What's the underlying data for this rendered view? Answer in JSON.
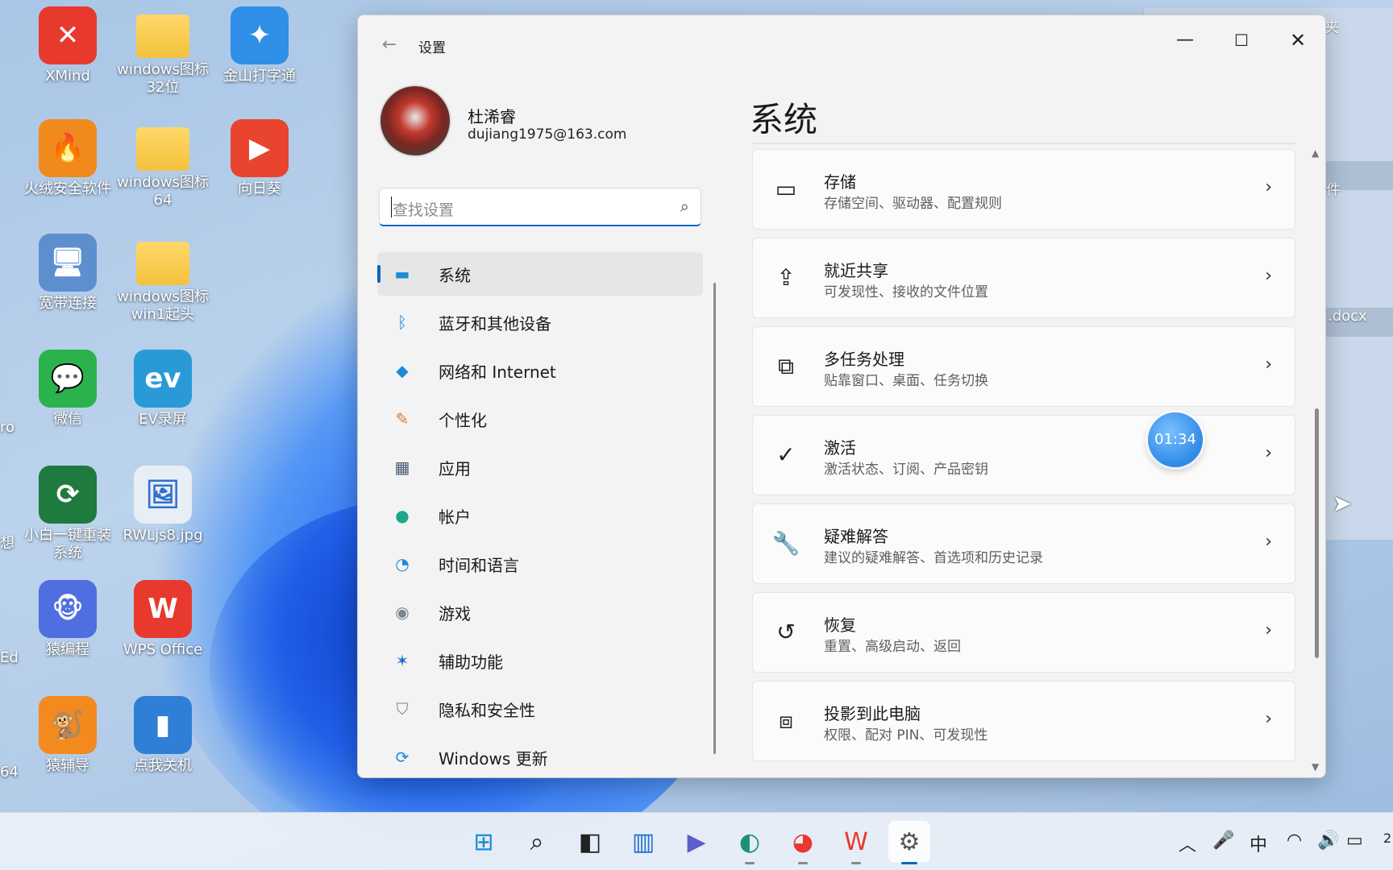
{
  "desktop": {
    "icons": [
      {
        "label": "XMind",
        "glyph": "✕",
        "color": "#e8392e",
        "icon": "xmind-icon"
      },
      {
        "label": "windows图标32位",
        "glyph": "",
        "color": "#f3c23c",
        "icon": "folder-icon"
      },
      {
        "label": "金山打字通",
        "glyph": "✦",
        "color": "#2f8ee6",
        "icon": "typing-app-icon"
      },
      {
        "label": "火绒安全软件",
        "glyph": "🔥",
        "color": "#f08a1c",
        "icon": "huorong-icon"
      },
      {
        "label": "windows图标64",
        "glyph": "",
        "color": "#f3c23c",
        "icon": "folder-icon"
      },
      {
        "label": "向日葵",
        "glyph": "▶",
        "color": "#e8442e",
        "icon": "sunflower-icon"
      },
      {
        "label": "宽带连接",
        "glyph": "🖥",
        "color": "#5d8fcf",
        "icon": "network-computer-icon"
      },
      {
        "label": "windows图标win1起头",
        "glyph": "",
        "color": "#f3c23c",
        "icon": "folder-icon"
      },
      {
        "label": "微信",
        "glyph": "💬",
        "color": "#2bb24c",
        "icon": "wechat-icon"
      },
      {
        "label": "EV录屏",
        "glyph": "ev",
        "color": "#2a9ad6",
        "icon": "ev-recorder-icon"
      },
      {
        "label": "小白一键重装系统",
        "glyph": "⟳",
        "color": "#1f7a3f",
        "icon": "reinstall-icon"
      },
      {
        "label": "RWLjs8.jpg",
        "glyph": "🖼",
        "color": "#e8eef5",
        "icon": "image-file-icon"
      },
      {
        "label": "猿编程",
        "glyph": "🐵",
        "color": "#4f6fe0",
        "icon": "yuanbiancheng-icon"
      },
      {
        "label": "WPS Office",
        "glyph": "W",
        "color": "#e8392e",
        "icon": "wps-icon"
      },
      {
        "label": "猿辅导",
        "glyph": "🐒",
        "color": "#f28a1e",
        "icon": "yuanfudao-icon"
      },
      {
        "label": "点我关机",
        "glyph": "▮",
        "color": "#2f7fd6",
        "icon": "shutdown-file-icon"
      }
    ],
    "edge_labels": [
      "ro",
      "想",
      "Ed",
      "64"
    ],
    "bg_window_labels": [
      "夹",
      "件",
      ".docx"
    ]
  },
  "window": {
    "title": "设置",
    "back_glyph": "←",
    "min_glyph": "—",
    "max_glyph": "☐",
    "close_glyph": "✕"
  },
  "profile": {
    "name": "杜浠睿",
    "email": "dujiang1975@163.com"
  },
  "search": {
    "placeholder": "查找设置",
    "icon_glyph": "⌕"
  },
  "nav": [
    {
      "label": "系统",
      "glyph": "▬",
      "color": "#1e8ad6",
      "selected": true,
      "name": "nav-system",
      "icon": "system-display-icon"
    },
    {
      "label": "蓝牙和其他设备",
      "glyph": "ᛒ",
      "color": "#1e8ad6",
      "selected": false,
      "name": "nav-bluetooth",
      "icon": "bluetooth-icon"
    },
    {
      "label": "网络和 Internet",
      "glyph": "◆",
      "color": "#1e8ad6",
      "selected": false,
      "name": "nav-network",
      "icon": "wifi-icon"
    },
    {
      "label": "个性化",
      "glyph": "✎",
      "color": "#d07a2c",
      "selected": false,
      "name": "nav-personalization",
      "icon": "brush-icon"
    },
    {
      "label": "应用",
      "glyph": "▦",
      "color": "#4a5a72",
      "selected": false,
      "name": "nav-apps",
      "icon": "apps-icon"
    },
    {
      "label": "帐户",
      "glyph": "●",
      "color": "#1fa58a",
      "selected": false,
      "name": "nav-accounts",
      "icon": "account-icon"
    },
    {
      "label": "时间和语言",
      "glyph": "◔",
      "color": "#1e8ad6",
      "selected": false,
      "name": "nav-time-language",
      "icon": "globe-clock-icon"
    },
    {
      "label": "游戏",
      "glyph": "◉",
      "color": "#7a8494",
      "selected": false,
      "name": "nav-gaming",
      "icon": "gamepad-icon"
    },
    {
      "label": "辅助功能",
      "glyph": "✶",
      "color": "#1e6fd0",
      "selected": false,
      "name": "nav-accessibility",
      "icon": "accessibility-icon"
    },
    {
      "label": "隐私和安全性",
      "glyph": "⛉",
      "color": "#7a8494",
      "selected": false,
      "name": "nav-privacy",
      "icon": "shield-icon"
    },
    {
      "label": "Windows 更新",
      "glyph": "⟳",
      "color": "#1e8ad6",
      "selected": false,
      "name": "nav-windows-update",
      "icon": "update-icon"
    }
  ],
  "main": {
    "title": "系统",
    "chevron": "›",
    "cards": [
      {
        "title": "存储",
        "subtitle": "存储空间、驱动器、配置规则",
        "glyph": "▭",
        "icon": "storage-icon",
        "name": "card-storage"
      },
      {
        "title": "就近共享",
        "subtitle": "可发现性、接收的文件位置",
        "glyph": "⇪",
        "icon": "share-icon",
        "name": "card-nearby-sharing"
      },
      {
        "title": "多任务处理",
        "subtitle": "贴靠窗口、桌面、任务切换",
        "glyph": "⧉",
        "icon": "multitasking-icon",
        "name": "card-multitasking"
      },
      {
        "title": "激活",
        "subtitle": "激活状态、订阅、产品密钥",
        "glyph": "✓",
        "icon": "activation-check-icon",
        "name": "card-activation"
      },
      {
        "title": "疑难解答",
        "subtitle": "建议的疑难解答、首选项和历史记录",
        "glyph": "🔧",
        "icon": "wrench-icon",
        "name": "card-troubleshoot"
      },
      {
        "title": "恢复",
        "subtitle": "重置、高级启动、返回",
        "glyph": "↺",
        "icon": "recovery-icon",
        "name": "card-recovery"
      },
      {
        "title": "投影到此电脑",
        "subtitle": "权限、配对 PIN、可发现性",
        "glyph": "⧈",
        "icon": "project-to-pc-icon",
        "name": "card-projecting"
      }
    ]
  },
  "overlay": {
    "timer": "01:34"
  },
  "taskbar": {
    "items": [
      {
        "glyph": "⊞",
        "color": "#1e8ad6",
        "name": "start-button",
        "icon": "windows-start-icon"
      },
      {
        "glyph": "⌕",
        "color": "#222",
        "name": "taskbar-search-button",
        "icon": "search-icon"
      },
      {
        "glyph": "◧",
        "color": "#222",
        "name": "task-view-button",
        "icon": "task-view-icon"
      },
      {
        "glyph": "▥",
        "color": "#1e6fd0",
        "name": "widgets-button",
        "icon": "widgets-icon"
      },
      {
        "glyph": "▶",
        "color": "#5b5fc7",
        "name": "chat-button",
        "icon": "teams-chat-icon"
      },
      {
        "glyph": "◐",
        "color": "#1d8f7a",
        "name": "edge-button",
        "icon": "edge-icon"
      },
      {
        "glyph": "◕",
        "color": "#e8392e",
        "name": "chrome-button",
        "icon": "chrome-icon"
      },
      {
        "glyph": "W",
        "color": "#e8392e",
        "name": "wps-taskbar-button",
        "icon": "wps-icon"
      },
      {
        "glyph": "⚙",
        "color": "#555",
        "name": "settings-taskbar-button",
        "icon": "settings-gear-icon",
        "active": true
      }
    ],
    "tray": [
      {
        "glyph": "︿",
        "name": "tray-overflow",
        "icon": "chevron-up-icon"
      },
      {
        "glyph": "🎤",
        "name": "tray-mic",
        "icon": "microphone-icon"
      },
      {
        "glyph": "中",
        "name": "tray-ime",
        "icon": "ime-icon"
      },
      {
        "glyph": "◠",
        "name": "tray-wifi",
        "icon": "wifi-icon"
      },
      {
        "glyph": "🔊",
        "name": "tray-volume",
        "icon": "speaker-icon"
      },
      {
        "glyph": "▭",
        "name": "tray-battery",
        "icon": "battery-icon"
      }
    ],
    "clock_fragment": "2"
  }
}
